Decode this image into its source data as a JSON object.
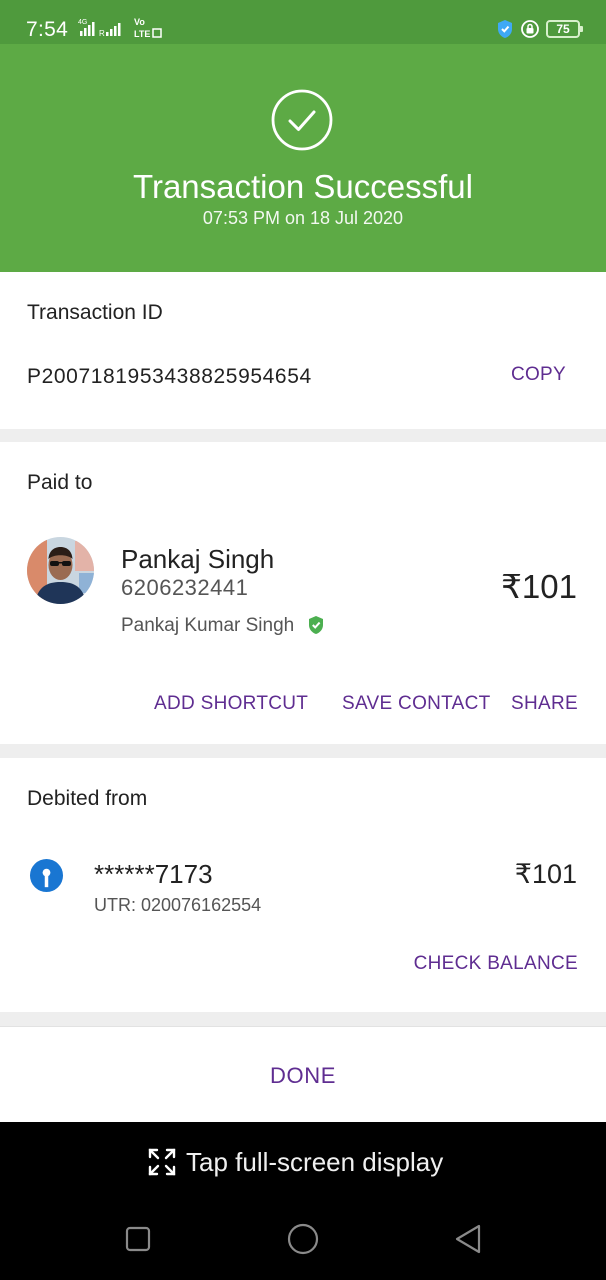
{
  "status_bar": {
    "time": "7:54",
    "network_small": "4G",
    "roaming": "R",
    "volte_top": "Vo",
    "volte_bottom": "LTE",
    "battery": "75",
    "icons": [
      "signal-icon",
      "shield-icon",
      "lock-icon",
      "battery-icon"
    ]
  },
  "header": {
    "title": "Transaction Successful",
    "subtitle": "07:53 PM on 18 Jul 2020",
    "bg_color": "#5daa45"
  },
  "transaction": {
    "label": "Transaction ID",
    "id": "P2007181953438825954654",
    "copy_label": "COPY"
  },
  "paid_to": {
    "label": "Paid to",
    "name": "Pankaj Singh",
    "phone": "6206232441",
    "legal_name": "Pankaj Kumar Singh",
    "amount": "₹101",
    "actions": {
      "add_shortcut": "ADD SHORTCUT",
      "save_contact": "SAVE CONTACT",
      "share": "SHARE"
    }
  },
  "debited_from": {
    "label": "Debited from",
    "account": "******7173",
    "utr": "UTR: 020076162554",
    "amount": "₹101",
    "check_balance": "CHECK BALANCE"
  },
  "done_label": "DONE",
  "fullscreen_prompt": "Tap full-screen display",
  "accent_color": "#5f2d91"
}
